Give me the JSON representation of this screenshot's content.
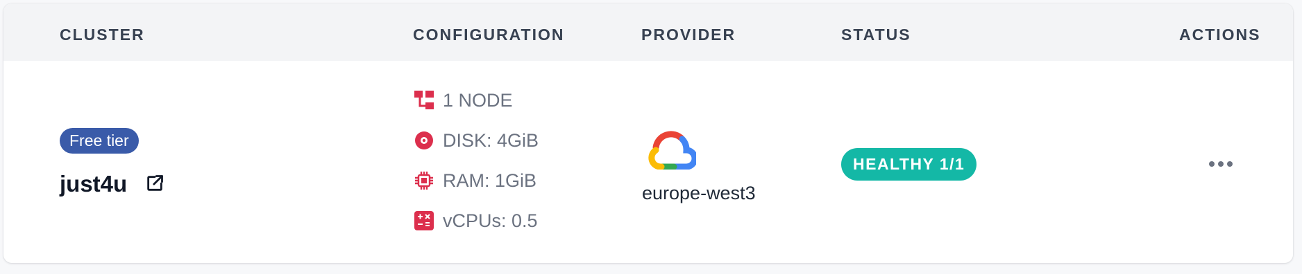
{
  "columns": {
    "cluster": "CLUSTER",
    "configuration": "CONFIGURATION",
    "provider": "PROVIDER",
    "status": "STATUS",
    "actions": "ACTIONS"
  },
  "row": {
    "tier_badge": "Free tier",
    "cluster_name": "just4u",
    "configuration": {
      "nodes": "1 NODE",
      "disk": "DISK: 4GiB",
      "ram": "RAM: 1GiB",
      "vcpus": "vCPUs: 0.5"
    },
    "provider": {
      "logo": "google-cloud-icon",
      "region": "europe-west3"
    },
    "status": "HEALTHY 1/1"
  },
  "icons": {
    "nodes": "nodes-icon",
    "disk": "disk-icon",
    "ram": "cpu-chip-icon",
    "vcpus": "calculator-icon",
    "external": "external-link-icon",
    "actions": "more-horizontal-icon"
  },
  "colors": {
    "header_bg": "#f3f4f6",
    "tier_badge": "#3a5ba9",
    "status_healthy": "#14b8a6",
    "config_icon": "#dc2f4d"
  }
}
